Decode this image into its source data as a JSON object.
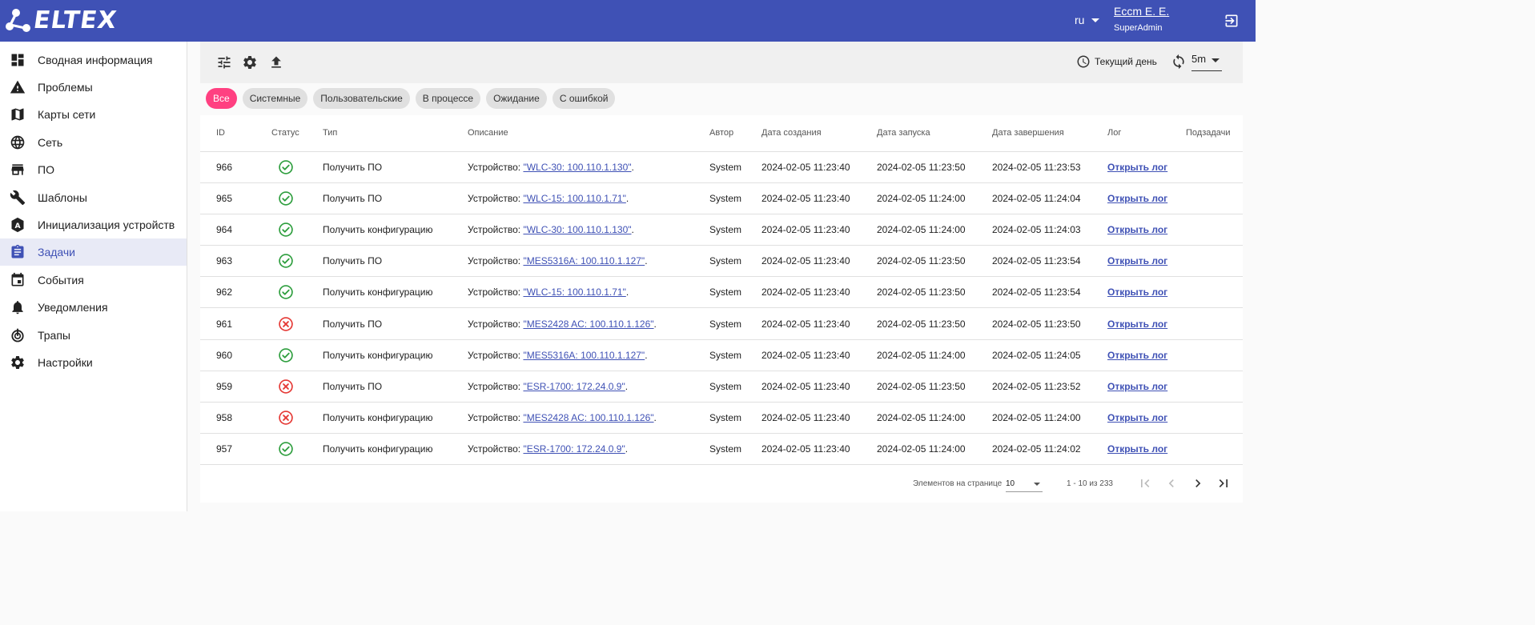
{
  "header": {
    "logo_text": "ELTEX",
    "language": "ru",
    "user_name": "Eccm E. E.",
    "user_role": "SuperAdmin",
    "brand_color": "#3f51b5"
  },
  "sidebar": {
    "items": [
      {
        "label": "Сводная информация",
        "icon": "dashboard-icon"
      },
      {
        "label": "Проблемы",
        "icon": "warning-icon"
      },
      {
        "label": "Карты сети",
        "icon": "map-icon"
      },
      {
        "label": "Сеть",
        "icon": "globe-icon"
      },
      {
        "label": "ПО",
        "icon": "store-icon"
      },
      {
        "label": "Шаблоны",
        "icon": "wrench-icon"
      },
      {
        "label": "Инициализация устройств",
        "icon": "auto-init-icon"
      },
      {
        "label": "Задачи",
        "icon": "clipboard-icon",
        "active": true
      },
      {
        "label": "События",
        "icon": "calendar-icon"
      },
      {
        "label": "Уведомления",
        "icon": "bell-icon"
      },
      {
        "label": "Трапы",
        "icon": "trap-icon"
      },
      {
        "label": "Настройки",
        "icon": "gear-icon"
      }
    ]
  },
  "toolbar": {
    "period_label": "Текущий день",
    "refresh_interval": "5m"
  },
  "filters": [
    "Все",
    "Системные",
    "Пользовательские",
    "В процессе",
    "Ожидание",
    "С ошибкой"
  ],
  "table": {
    "columns": [
      "ID",
      "Статус",
      "Тип",
      "Описание",
      "Автор",
      "Дата создания",
      "Дата запуска",
      "Дата завершения",
      "Лог",
      "Подзадачи"
    ],
    "rows": [
      {
        "id": "966",
        "status": "success",
        "type": "Получить ПО",
        "desc_prefix": "Устройство: ",
        "device": "\"WLC-30: 100.110.1.130\"",
        "desc_suffix": ".",
        "author": "System",
        "created": "2024-02-05 11:23:40",
        "started": "2024-02-05 11:23:50",
        "finished": "2024-02-05 11:23:53",
        "log": "Открыть лог"
      },
      {
        "id": "965",
        "status": "success",
        "type": "Получить ПО",
        "desc_prefix": "Устройство: ",
        "device": "\"WLC-15: 100.110.1.71\"",
        "desc_suffix": ".",
        "author": "System",
        "created": "2024-02-05 11:23:40",
        "started": "2024-02-05 11:24:00",
        "finished": "2024-02-05 11:24:04",
        "log": "Открыть лог"
      },
      {
        "id": "964",
        "status": "success",
        "type": "Получить конфигурацию",
        "desc_prefix": "Устройство: ",
        "device": "\"WLC-30: 100.110.1.130\"",
        "desc_suffix": ".",
        "author": "System",
        "created": "2024-02-05 11:23:40",
        "started": "2024-02-05 11:24:00",
        "finished": "2024-02-05 11:24:03",
        "log": "Открыть лог"
      },
      {
        "id": "963",
        "status": "success",
        "type": "Получить ПО",
        "desc_prefix": "Устройство: ",
        "device": "\"MES5316A: 100.110.1.127\"",
        "desc_suffix": ".",
        "author": "System",
        "created": "2024-02-05 11:23:40",
        "started": "2024-02-05 11:23:50",
        "finished": "2024-02-05 11:23:54",
        "log": "Открыть лог"
      },
      {
        "id": "962",
        "status": "success",
        "type": "Получить конфигурацию",
        "desc_prefix": "Устройство: ",
        "device": "\"WLC-15: 100.110.1.71\"",
        "desc_suffix": ".",
        "author": "System",
        "created": "2024-02-05 11:23:40",
        "started": "2024-02-05 11:23:50",
        "finished": "2024-02-05 11:23:54",
        "log": "Открыть лог"
      },
      {
        "id": "961",
        "status": "error",
        "type": "Получить ПО",
        "desc_prefix": "Устройство: ",
        "device": "\"MES2428 AC: 100.110.1.126\"",
        "desc_suffix": ".",
        "author": "System",
        "created": "2024-02-05 11:23:40",
        "started": "2024-02-05 11:23:50",
        "finished": "2024-02-05 11:23:50",
        "log": "Открыть лог"
      },
      {
        "id": "960",
        "status": "success",
        "type": "Получить конфигурацию",
        "desc_prefix": "Устройство: ",
        "device": "\"MES5316A: 100.110.1.127\"",
        "desc_suffix": ".",
        "author": "System",
        "created": "2024-02-05 11:23:40",
        "started": "2024-02-05 11:24:00",
        "finished": "2024-02-05 11:24:05",
        "log": "Открыть лог"
      },
      {
        "id": "959",
        "status": "error",
        "type": "Получить ПО",
        "desc_prefix": "Устройство: ",
        "device": "\"ESR-1700: 172.24.0.9\"",
        "desc_suffix": ".",
        "author": "System",
        "created": "2024-02-05 11:23:40",
        "started": "2024-02-05 11:23:50",
        "finished": "2024-02-05 11:23:52",
        "log": "Открыть лог"
      },
      {
        "id": "958",
        "status": "error",
        "type": "Получить конфигурацию",
        "desc_prefix": "Устройство: ",
        "device": "\"MES2428 AC: 100.110.1.126\"",
        "desc_suffix": ".",
        "author": "System",
        "created": "2024-02-05 11:23:40",
        "started": "2024-02-05 11:24:00",
        "finished": "2024-02-05 11:24:00",
        "log": "Открыть лог"
      },
      {
        "id": "957",
        "status": "success",
        "type": "Получить конфигурацию",
        "desc_prefix": "Устройство: ",
        "device": "\"ESR-1700: 172.24.0.9\"",
        "desc_suffix": ".",
        "author": "System",
        "created": "2024-02-05 11:23:40",
        "started": "2024-02-05 11:24:00",
        "finished": "2024-02-05 11:24:02",
        "log": "Открыть лог"
      }
    ]
  },
  "paginator": {
    "items_per_page_label": "Элементов на странице",
    "page_size": "10",
    "range_label": "1 - 10 из 233"
  },
  "colors": {
    "success": "#2e9e3e",
    "error": "#e53935",
    "accent": "#ff4081",
    "link": "#3f51b5"
  }
}
